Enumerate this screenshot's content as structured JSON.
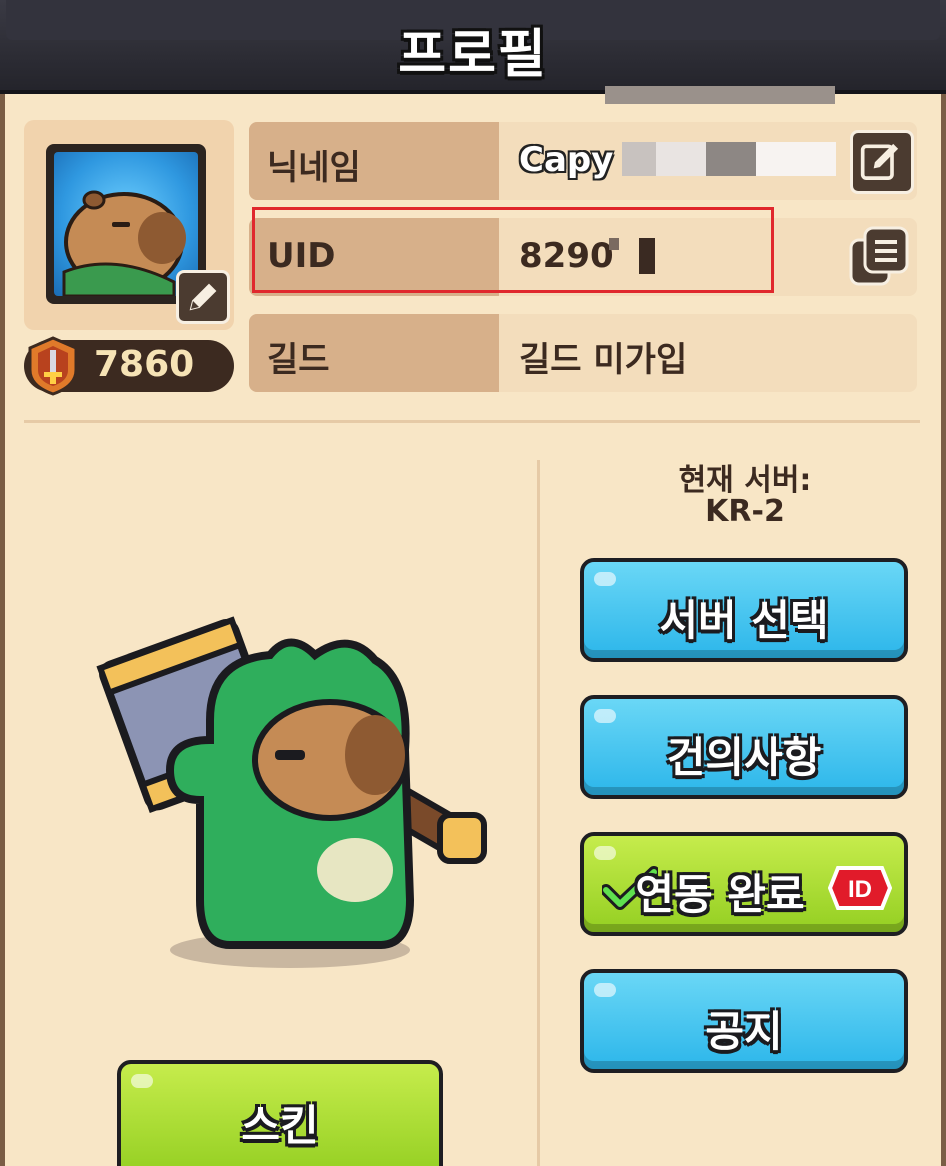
{
  "header": {
    "title": "프로필"
  },
  "profile": {
    "power": "7860",
    "rows": {
      "nickname": {
        "label": "닉네임",
        "value": "Capy"
      },
      "uid": {
        "label": "UID",
        "value": "8290"
      },
      "guild": {
        "label": "길드",
        "value": "길드 미가입"
      }
    }
  },
  "server": {
    "label": "현재 서버:",
    "value": "KR-2"
  },
  "buttons": {
    "server_select": "서버 선택",
    "suggestions": "건의사항",
    "link_complete": "연동 완료",
    "link_badge": "ID",
    "notice": "공지",
    "skin": "스킨"
  },
  "icons": [
    "edit-icon",
    "copy-icon",
    "sword-badge-icon",
    "checkmark-icon"
  ],
  "colors": {
    "panel": "#f8e6c6",
    "label_bg": "#d7b08a",
    "blue_button": "#2cb6ea",
    "green_button": "#94cf22",
    "highlight": "#e0282d"
  }
}
